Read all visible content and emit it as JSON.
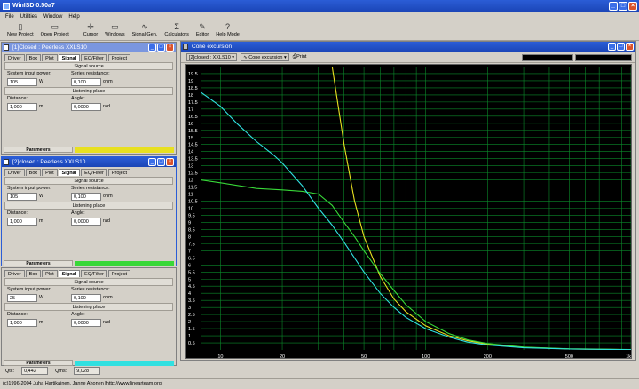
{
  "app": {
    "title": "WinISD 0.50a7"
  },
  "menu": [
    "File",
    "Utilities",
    "Window",
    "Help"
  ],
  "toolbar": [
    {
      "label": "New Project",
      "icon": "doc-icon"
    },
    {
      "label": "Open Project",
      "icon": "folder-icon"
    },
    {
      "label": "Cursor",
      "icon": "cursor-icon"
    },
    {
      "label": "Windows",
      "icon": "windows-icon"
    },
    {
      "label": "Signal Gen.",
      "icon": "wave-icon"
    },
    {
      "label": "Calculators",
      "icon": "calc-icon"
    },
    {
      "label": "Editor",
      "icon": "editor-icon"
    },
    {
      "label": "Help Mode",
      "icon": "help-icon"
    }
  ],
  "panels": [
    {
      "title": "[1]Closed : Peerless XXLS10",
      "tabs": [
        "Driver",
        "Box",
        "Plot",
        "Signal",
        "EQ/Filter",
        "Project"
      ],
      "power": "105",
      "resistance": "0,100",
      "distance": "1,000",
      "angle": "0,0000",
      "color": "#e8e020"
    },
    {
      "title": "[2]closed : Peerless XXLS10",
      "tabs": [
        "Driver",
        "Box",
        "Plot",
        "Signal",
        "EQ/Filter",
        "Project"
      ],
      "power": "105",
      "resistance": "0,100",
      "distance": "1,000",
      "angle": "0,0000",
      "color": "#38d838"
    },
    {
      "title": "",
      "tabs": [
        "Driver",
        "Box",
        "Plot",
        "Signal",
        "EQ/Filter",
        "Project"
      ],
      "power": "25",
      "resistance": "0,100",
      "distance": "1,000",
      "angle": "0,0000",
      "color": "#30e0e0"
    }
  ],
  "labels": {
    "signal_source": "Signal source",
    "system_input_power": "System input power:",
    "series_resistance": "Series resistance:",
    "listening_place": "Listening place",
    "distance": "Distance:",
    "angle": "Angle:",
    "unit_w": "W",
    "unit_ohm": "ohm",
    "unit_m": "m",
    "unit_rad": "rad",
    "parameters": "Parameters"
  },
  "readout": {
    "qtc_label": "Qtc:",
    "qtc": "0,443",
    "qms_label": "Qms:",
    "qms": "9,028"
  },
  "chart_window": {
    "title": "Cone excursion",
    "project_select": "[2]closed : XXLS10",
    "plot_select": "Cone excursion",
    "print": "Print"
  },
  "chart_data": {
    "type": "line",
    "x_scale": "log",
    "xlim": [
      8,
      1000
    ],
    "ylim": [
      0,
      20
    ],
    "x_ticks": [
      "10",
      "20",
      "50",
      "100",
      "200",
      "500",
      "1k"
    ],
    "y_ticks": [
      "0.5",
      "1",
      "1.5",
      "2",
      "2.5",
      "3",
      "3.5",
      "4",
      "4.5",
      "5",
      "5.5",
      "6",
      "6.5",
      "7",
      "7.5",
      "8",
      "8.5",
      "9",
      "9.5",
      "10",
      "10.5",
      "11",
      "11.5",
      "12",
      "12.5",
      "13",
      "13.5",
      "14",
      "14.5",
      "15",
      "15.5",
      "16",
      "16.5",
      "17",
      "17.5",
      "18",
      "18.5",
      "19",
      "19.5"
    ],
    "grid": true,
    "series": [
      {
        "color": "#e8e020",
        "points": [
          [
            35,
            20
          ],
          [
            40,
            14.5
          ],
          [
            45,
            10.5
          ],
          [
            50,
            8
          ],
          [
            60,
            5.2
          ],
          [
            70,
            3.6
          ],
          [
            80,
            2.7
          ],
          [
            100,
            1.7
          ],
          [
            130,
            1
          ],
          [
            160,
            0.65
          ],
          [
            200,
            0.4
          ],
          [
            300,
            0.18
          ],
          [
            500,
            0.07
          ],
          [
            1000,
            0.02
          ]
        ]
      },
      {
        "color": "#38d838",
        "points": [
          [
            8,
            12
          ],
          [
            10,
            11.8
          ],
          [
            15,
            11.4
          ],
          [
            20,
            11.3
          ],
          [
            25,
            11.2
          ],
          [
            30,
            11
          ],
          [
            35,
            10.2
          ],
          [
            40,
            9
          ],
          [
            45,
            8
          ],
          [
            50,
            7
          ],
          [
            60,
            5.4
          ],
          [
            70,
            4.2
          ],
          [
            80,
            3.2
          ],
          [
            100,
            2
          ],
          [
            130,
            1.15
          ],
          [
            160,
            0.72
          ],
          [
            200,
            0.45
          ],
          [
            300,
            0.2
          ],
          [
            500,
            0.08
          ],
          [
            1000,
            0.03
          ]
        ]
      },
      {
        "color": "#30e0e0",
        "points": [
          [
            8,
            18.2
          ],
          [
            10,
            17.2
          ],
          [
            12,
            16
          ],
          [
            15,
            14.7
          ],
          [
            18,
            13.8
          ],
          [
            20,
            13.2
          ],
          [
            25,
            11.6
          ],
          [
            30,
            10
          ],
          [
            35,
            8.8
          ],
          [
            40,
            7.6
          ],
          [
            50,
            5.5
          ],
          [
            60,
            4
          ],
          [
            70,
            3
          ],
          [
            80,
            2.3
          ],
          [
            100,
            1.5
          ],
          [
            130,
            0.9
          ],
          [
            160,
            0.55
          ],
          [
            200,
            0.35
          ],
          [
            300,
            0.15
          ],
          [
            500,
            0.06
          ],
          [
            1000,
            0.02
          ]
        ]
      }
    ]
  },
  "status": "(c)1996-2004 Juha Hartikainen, Janne Ahonen [http://www.linearteam.org]"
}
